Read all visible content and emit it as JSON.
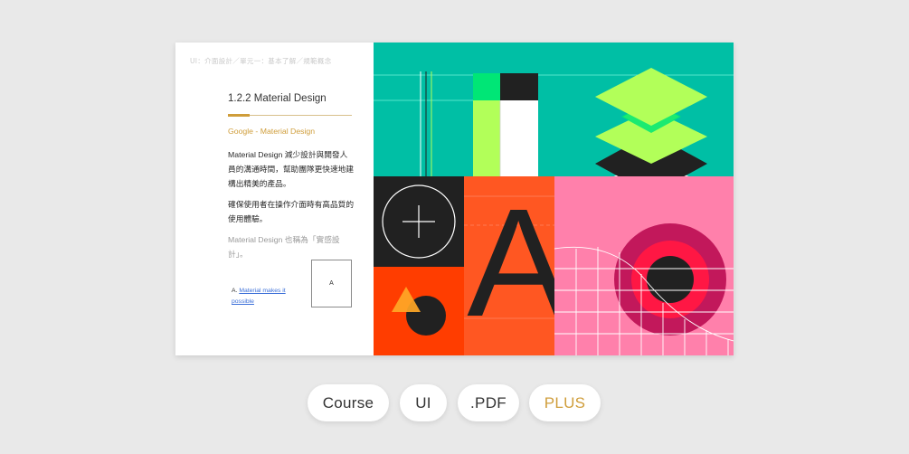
{
  "slide": {
    "breadcrumb": "UI：介面設計／單元一：基本了解／規範概念",
    "title": "1.2.2 Material Design",
    "subtitle": "Google - Material Design",
    "paragraph1": "Material Design 減少設計與開發人員的溝通時間，幫助團隊更快速地建構出精美的產品。",
    "paragraph2": "確保使用者在操作介面時有高品質的使用體驗。",
    "paragraph3": "Material Design 也稱為「實感設計」。",
    "footnote_marker": "A.",
    "footnote_link": "Material makes it possible",
    "thumbnail_label": "A",
    "art_letter": "A"
  },
  "tags": {
    "course": "Course",
    "ui": "UI",
    "pdf": ".PDF",
    "plus": "PLUS"
  },
  "colors": {
    "background": "#e9e9e9",
    "accent_gold": "#cf9d3a",
    "teal": "#00bfa5",
    "lime": "#b2ff59",
    "green": "#00e676",
    "dark": "#212121",
    "orange": "#ff5722",
    "red_orange": "#ff3d00",
    "pink": "#ff80ab",
    "magenta": "#c2185b",
    "red": "#ff1744",
    "amber": "#ffa726",
    "link_blue": "#3b6fd8"
  }
}
